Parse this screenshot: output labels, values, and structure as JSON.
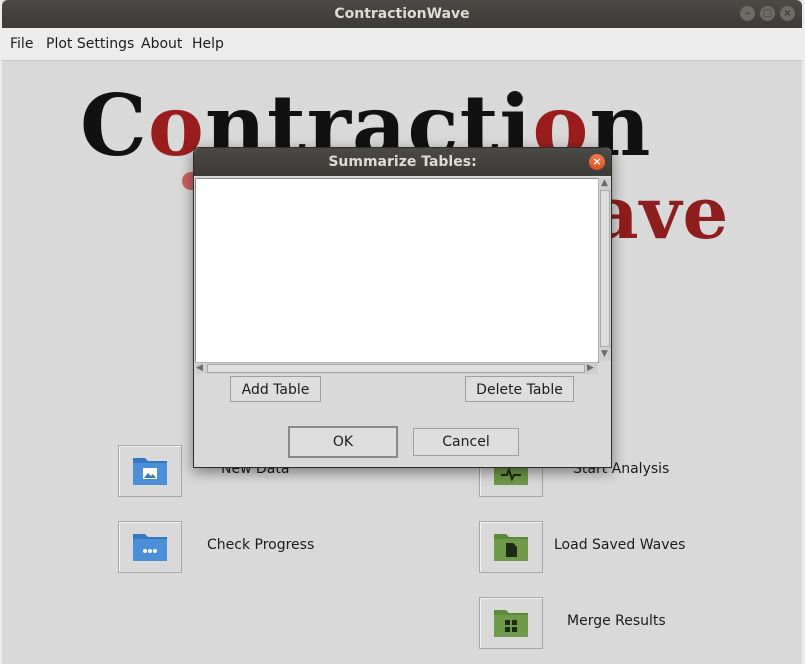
{
  "window": {
    "title": "ContractionWave"
  },
  "menu": [
    "File",
    "Plot Settings",
    "About",
    "Help"
  ],
  "logo": {
    "line1_a": "C",
    "line1_b": "o",
    "line1_c": "ntracti",
    "line1_d": "o",
    "line1_e": "n",
    "line2": "ave"
  },
  "main_buttons": {
    "new_data": "New Data",
    "check_progress": "Check Progress",
    "start_analysis": "Start Analysis",
    "load_saved_waves": "Load Saved Waves",
    "merge_results": "Merge Results"
  },
  "dialog": {
    "title": "Summarize Tables:",
    "add_table": "Add Table",
    "delete_table": "Delete Table",
    "ok": "OK",
    "cancel": "Cancel"
  },
  "colors": {
    "folder_blue": "#4a8fd8",
    "folder_green": "#6e9a4a",
    "logo_red": "#9a1d1d"
  },
  "icons": [
    "image-folder-icon",
    "progress-folder-icon",
    "waveform-folder-icon",
    "document-folder-icon",
    "grid-folder-icon",
    "close-icon",
    "minimize-icon",
    "maximize-icon"
  ]
}
